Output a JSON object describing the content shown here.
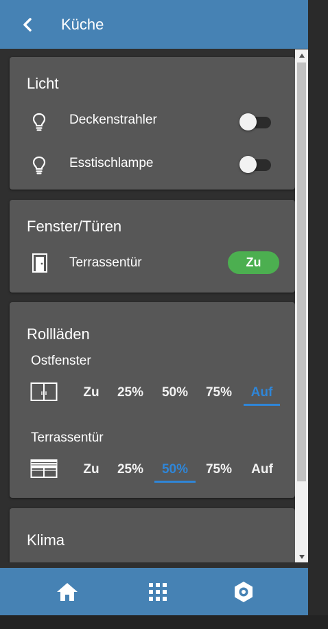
{
  "header": {
    "title": "Küche"
  },
  "light": {
    "title": "Licht",
    "items": [
      {
        "label": "Deckenstrahler",
        "on": false
      },
      {
        "label": "Esstischlampe",
        "on": false
      }
    ]
  },
  "windows": {
    "title": "Fenster/Türen",
    "items": [
      {
        "label": "Terrassentür",
        "status": "Zu",
        "status_color": "#4caf50"
      }
    ]
  },
  "shutters": {
    "title": "Rollläden",
    "options": [
      "Zu",
      "25%",
      "50%",
      "75%",
      "Auf"
    ],
    "items": [
      {
        "label": "Ostfenster",
        "selected": "Auf"
      },
      {
        "label": "Terrassentür",
        "selected": "50%"
      }
    ]
  },
  "climate": {
    "title": "Klima"
  },
  "nav": [
    "home-icon",
    "grid-icon",
    "settings-icon"
  ],
  "colors": {
    "accent": "#4682b4",
    "active": "#2f86d8",
    "card": "#575757"
  }
}
